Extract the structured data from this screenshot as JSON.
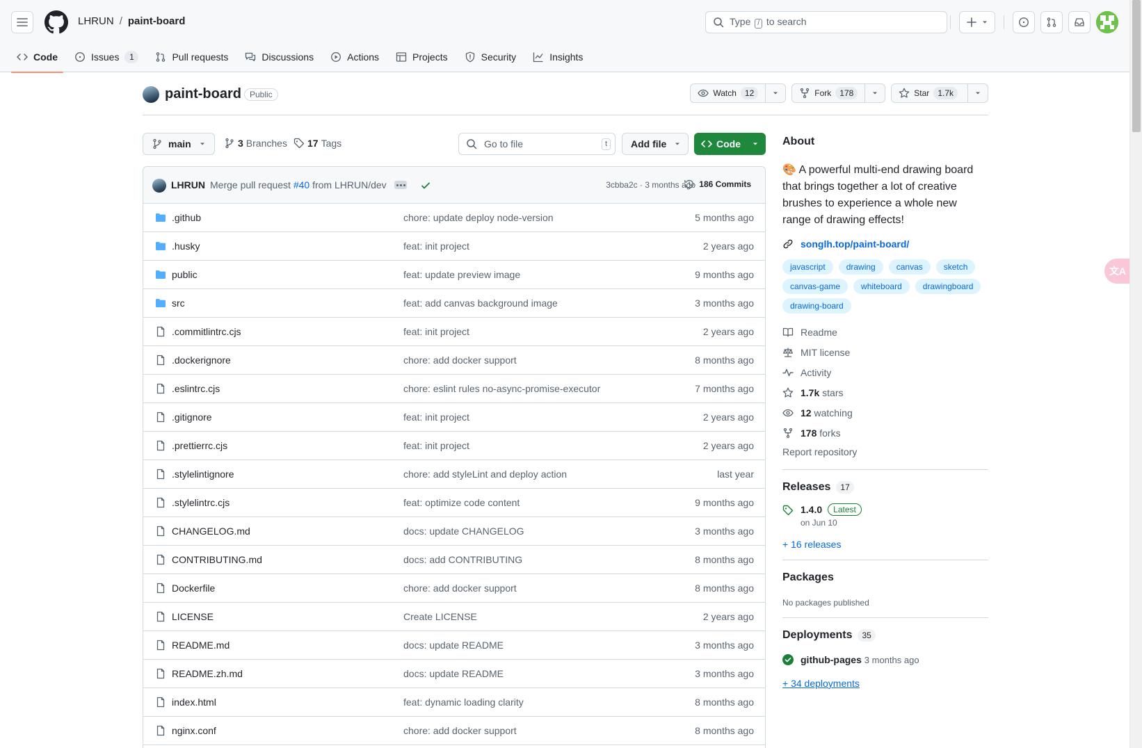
{
  "header": {
    "owner": "LHRUN",
    "separator": "/",
    "repo": "paint-board",
    "search_pre": "Type",
    "search_key": "/",
    "search_post": "to search"
  },
  "tabs": [
    {
      "label": "Code",
      "icon": "code-icon"
    },
    {
      "label": "Issues",
      "count": "1",
      "icon": "issue-icon"
    },
    {
      "label": "Pull requests",
      "icon": "pull-request-icon"
    },
    {
      "label": "Discussions",
      "icon": "discussions-icon"
    },
    {
      "label": "Actions",
      "icon": "play-icon"
    },
    {
      "label": "Projects",
      "icon": "table-icon"
    },
    {
      "label": "Security",
      "icon": "shield-icon"
    },
    {
      "label": "Insights",
      "icon": "graph-icon"
    }
  ],
  "repo": {
    "name": "paint-board",
    "visibility": "Public",
    "watch_label": "Watch",
    "watch_count": "12",
    "fork_label": "Fork",
    "fork_count": "178",
    "star_label": "Star",
    "star_count": "1.7k"
  },
  "branch_bar": {
    "branch": "main",
    "branches_count": "3",
    "branches_label": "Branches",
    "tags_count": "17",
    "tags_label": "Tags",
    "goto_placeholder": "Go to file",
    "goto_key": "t",
    "add_file": "Add file",
    "code_button": "Code"
  },
  "latest_commit": {
    "author": "LHRUN",
    "message_pre": "Merge pull request",
    "pr": "#40",
    "message_post": "from LHRUN/dev",
    "hash_time": "3cbba2c · 3 months ago",
    "commits": "186 Commits"
  },
  "files": [
    {
      "name": ".github",
      "type": "dir",
      "message": "chore: update deploy node-version",
      "time": "5 months ago"
    },
    {
      "name": ".husky",
      "type": "dir",
      "message": "feat: init project",
      "time": "2 years ago"
    },
    {
      "name": "public",
      "type": "dir",
      "message": "feat: update preview image",
      "time": "9 months ago"
    },
    {
      "name": "src",
      "type": "dir",
      "message": "feat: add canvas background image",
      "time": "3 months ago"
    },
    {
      "name": ".commitlintrc.cjs",
      "type": "file",
      "message": "feat: init project",
      "time": "2 years ago"
    },
    {
      "name": ".dockerignore",
      "type": "file",
      "message": "chore: add docker support",
      "time": "8 months ago"
    },
    {
      "name": ".eslintrc.cjs",
      "type": "file",
      "message": "chore: eslint rules no-async-promise-executor",
      "time": "7 months ago"
    },
    {
      "name": ".gitignore",
      "type": "file",
      "message": "feat: init project",
      "time": "2 years ago"
    },
    {
      "name": ".prettierrc.cjs",
      "type": "file",
      "message": "feat: init project",
      "time": "2 years ago"
    },
    {
      "name": ".stylelintignore",
      "type": "file",
      "message": "chore: add styleLint and deploy action",
      "time": "last year"
    },
    {
      "name": ".stylelintrc.cjs",
      "type": "file",
      "message": "feat: optimize code content",
      "time": "9 months ago"
    },
    {
      "name": "CHANGELOG.md",
      "type": "file",
      "message": "docs: update CHANGELOG",
      "time": "3 months ago"
    },
    {
      "name": "CONTRIBUTING.md",
      "type": "file",
      "message": "docs: add CONTRIBUTING",
      "time": "8 months ago"
    },
    {
      "name": "Dockerfile",
      "type": "file",
      "message": "chore: add docker support",
      "time": "8 months ago"
    },
    {
      "name": "LICENSE",
      "type": "file",
      "message": "Create LICENSE",
      "time": "2 years ago"
    },
    {
      "name": "README.md",
      "type": "file",
      "message": "docs: update README",
      "time": "3 months ago"
    },
    {
      "name": "README.zh.md",
      "type": "file",
      "message": "docs: update README",
      "time": "3 months ago"
    },
    {
      "name": "index.html",
      "type": "file",
      "message": "feat: dynamic loading clarity",
      "time": "8 months ago"
    },
    {
      "name": "nginx.conf",
      "type": "file",
      "message": "chore: add docker support",
      "time": "8 months ago"
    }
  ],
  "about": {
    "title": "About",
    "emoji": "🎨",
    "description": "A powerful multi-end drawing board that brings together a lot of creative brushes to experience a whole new range of drawing effects!",
    "link": "songlh.top/paint-board/",
    "topics": [
      "javascript",
      "drawing",
      "canvas",
      "sketch",
      "canvas-game",
      "whiteboard",
      "drawingboard",
      "drawing-board"
    ],
    "readme": "Readme",
    "license": "MIT license",
    "activity": "Activity",
    "stars_count": "1.7k",
    "stars_label": "stars",
    "watching_count": "12",
    "watching_label": "watching",
    "forks_count": "178",
    "forks_label": "forks",
    "report": "Report repository"
  },
  "releases": {
    "title": "Releases",
    "count": "17",
    "version": "1.4.0",
    "latest": "Latest",
    "date": "on Jun 10",
    "more": "+ 16 releases"
  },
  "packages": {
    "title": "Packages",
    "empty": "No packages published"
  },
  "deployments": {
    "title": "Deployments",
    "count": "35",
    "env": "github-pages",
    "time": "3 months ago",
    "more": "+ 34 deployments"
  },
  "floating": {
    "translate_glyph": "文A"
  },
  "colors": {
    "accent_green": "#1f883d",
    "link_blue": "#0969da",
    "tab_underline": "#fd8c73",
    "folder_blue": "#54aeff"
  }
}
